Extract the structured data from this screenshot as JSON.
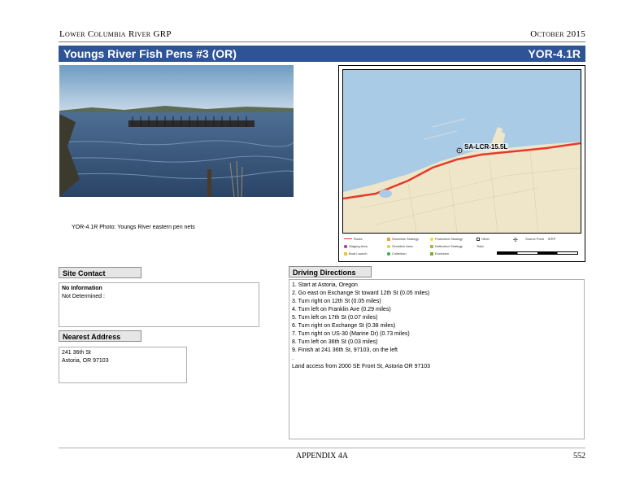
{
  "header": {
    "left": "Lower Columbia River GRP",
    "right": "October 2015"
  },
  "title": {
    "name": "Youngs River Fish Pens #3 (OR)",
    "code": "YOR-4.1R"
  },
  "photo": {
    "caption": "YOR-4.1R Photo: Youngs River eastern pen nets"
  },
  "map": {
    "site_label": "SA-LCR-15.5L",
    "legend": [
      "Route",
      "Staging Area",
      "Boat Launch",
      "Shoreline Strategy",
      "Sensitive Area",
      "Collection",
      "Protection Strategy",
      "Deflection Strategy",
      "Exclusion",
      "Other",
      "Tidal",
      "Source Point",
      "IERP"
    ],
    "colors": {
      "water": "#a9cbe6",
      "land": "#efe6c9",
      "route": "#e53a2a"
    }
  },
  "site_contact": {
    "label": "Site Contact",
    "line1": "No Information",
    "line2": "Not Determined :"
  },
  "nearest_address": {
    "label": "Nearest Address",
    "line1": "241 36th St",
    "line2": "Astoria, OR 97103"
  },
  "driving": {
    "label": "Driving Directions",
    "steps": [
      "1. Start at Astoria, Oregon",
      "2. Go east on Exchange St toward 12th St (0.05 miles)",
      "3. Turn right on 12th St (0.05 miles)",
      "4. Turn left on Franklin Ave (0.29 miles)",
      "5. Turn left on 17th St (0.07 miles)",
      "6. Turn right on Exchange St (0.38 miles)",
      "7. Turn right on US-30 (Marine Dr) (0.73 miles)",
      "8. Turn left on 36th St (0.03 miles)",
      "9. Finish at 241 36th St, 97103, on the left",
      "."
    ],
    "land_access": "Land access from 2000 SE Front St, Astoria OR 97103"
  },
  "footer": {
    "center": "APPENDIX 4A",
    "page": "552"
  }
}
